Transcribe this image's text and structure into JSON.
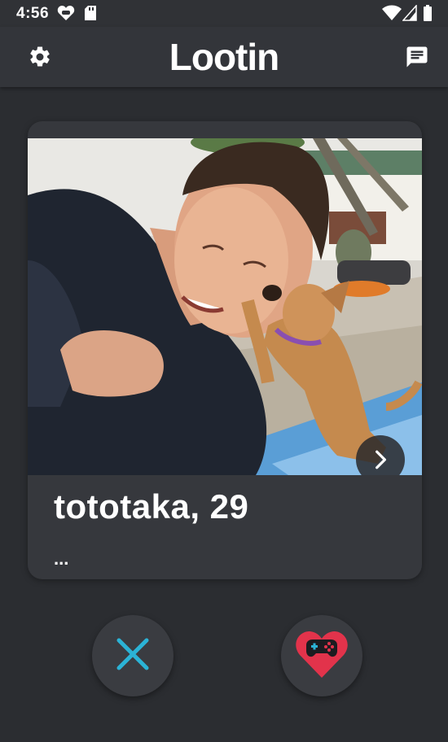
{
  "status_bar": {
    "time": "4:56",
    "left_icons": [
      "heart-game-icon",
      "sd-card-icon"
    ],
    "right_icons": [
      "wifi-icon",
      "signal-icon",
      "battery-icon"
    ]
  },
  "app_bar": {
    "title": "Lootin",
    "left_icon": "gear-icon",
    "right_icon": "chat-icon"
  },
  "profile_card": {
    "name_age": "tototaka, 29",
    "bio": "...",
    "next_icon": "chevron-right-icon"
  },
  "actions": {
    "dislike_icon": "close-icon",
    "like_icon": "heart-gamepad-icon"
  },
  "colors": {
    "background": "#2b2d31",
    "card": "#36383d",
    "dislike_accent": "#2bb3d6",
    "like_accent": "#e2334b"
  }
}
